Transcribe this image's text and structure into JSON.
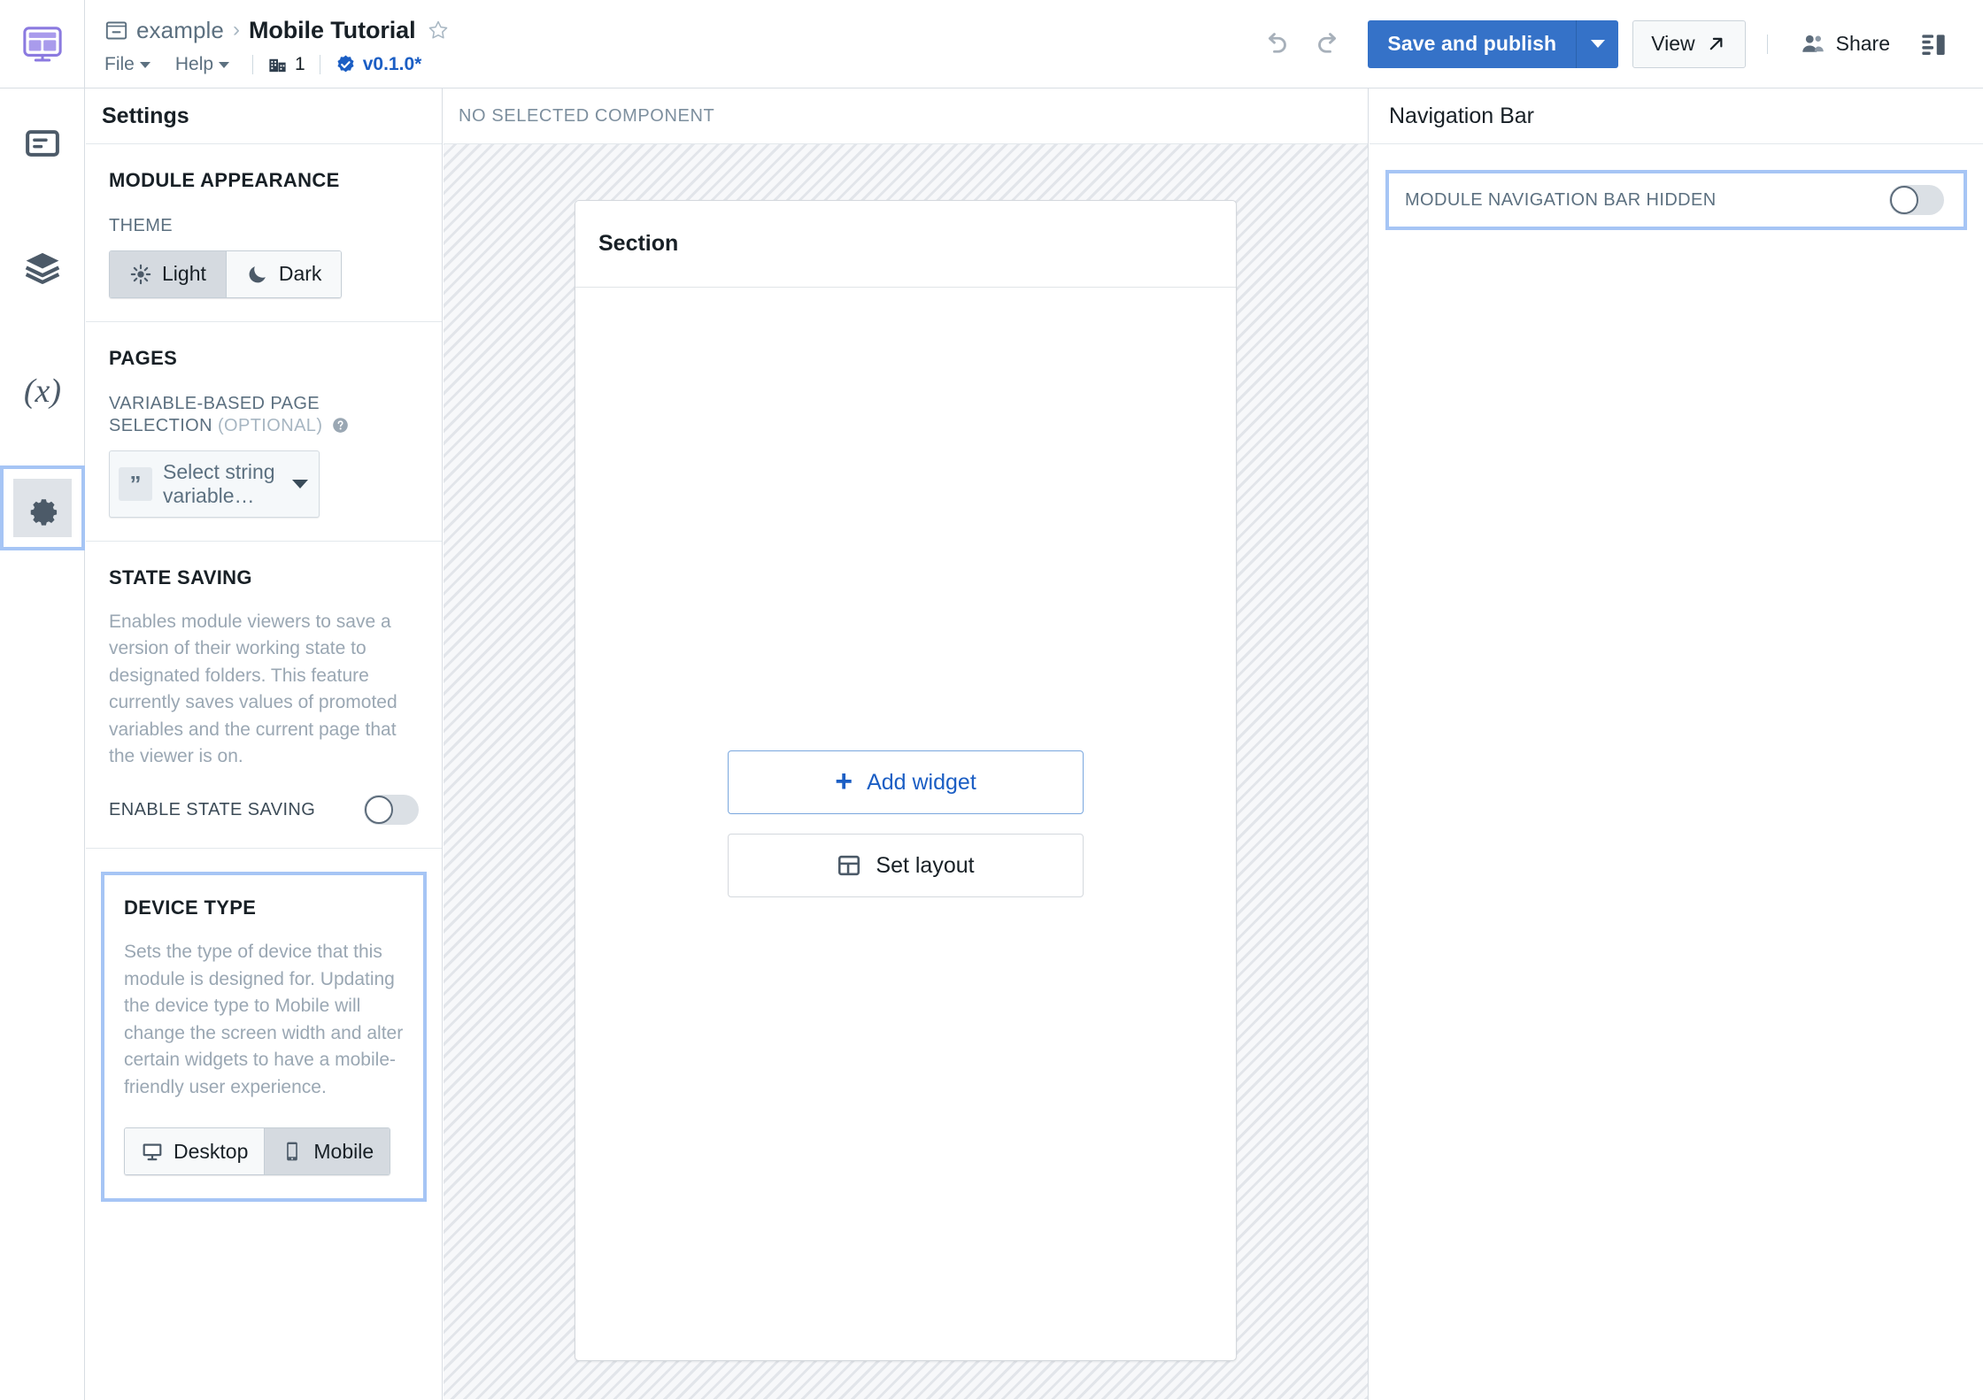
{
  "topbar": {
    "logo_icon": "workshop-logo-icon",
    "breadcrumb_parent": "example",
    "breadcrumb_separator": "›",
    "breadcrumb_current": "Mobile Tutorial",
    "star_icon": "star-outline-icon",
    "menu_file": "File",
    "menu_help": "Help",
    "org_icon": "organization-icon",
    "org_count": "1",
    "version_icon": "verified-badge-icon",
    "version_label": "v0.1.0*",
    "undo_icon": "undo-icon",
    "redo_icon": "redo-icon",
    "save_label": "Save and publish",
    "save_caret_icon": "chevron-down-icon",
    "view_label": "View",
    "view_icon": "external-link-icon",
    "share_icon": "people-icon",
    "share_label": "Share",
    "panel_toggle_icon": "panel-layout-icon"
  },
  "rail": {
    "items": [
      {
        "icon": "overview-panel-icon",
        "name": "sidebar-item-overview",
        "active": false
      },
      {
        "icon": "layers-icon",
        "name": "sidebar-item-layers",
        "active": false
      },
      {
        "icon": "variables-icon",
        "name": "sidebar-item-variables",
        "active": false
      },
      {
        "icon": "gear-icon",
        "name": "sidebar-item-settings",
        "active": true
      }
    ]
  },
  "settings": {
    "panel_title": "Settings",
    "appearance": {
      "section_title": "MODULE APPEARANCE",
      "theme_label": "THEME",
      "light_label": "Light",
      "light_icon": "sun-icon",
      "dark_label": "Dark",
      "dark_icon": "moon-icon",
      "selected": "Light"
    },
    "pages": {
      "section_title": "PAGES",
      "field_label": "VARIABLE-BASED PAGE SELECTION",
      "field_optional": "(OPTIONAL)",
      "help_icon": "help-circle-icon",
      "select_icon": "string-quote-icon",
      "select_glyph": "”",
      "select_value": "Select string variable…",
      "caret_icon": "chevron-down-icon"
    },
    "state_saving": {
      "section_title": "STATE SAVING",
      "description": "Enables module viewers to save a version of their working state to designated folders. This feature currently saves values of promoted variables and the current page that the viewer is on.",
      "toggle_label": "ENABLE STATE SAVING",
      "toggle_state": "off"
    },
    "device_type": {
      "section_title": "DEVICE TYPE",
      "description": "Sets the type of device that this module is designed for. Updating the device type to Mobile will change the screen width and alter certain widgets to have a mobile-friendly user experience.",
      "desktop_label": "Desktop",
      "desktop_icon": "desktop-monitor-icon",
      "mobile_label": "Mobile",
      "mobile_icon": "mobile-phone-icon",
      "selected": "Mobile",
      "highlighted": true
    }
  },
  "canvas": {
    "header_label": "NO SELECTED COMPONENT",
    "section_title": "Section",
    "add_widget_label": "Add widget",
    "add_widget_icon": "plus-icon",
    "set_layout_label": "Set layout",
    "set_layout_icon": "layout-grid-icon"
  },
  "right_panel": {
    "title": "Navigation Bar",
    "row_label": "MODULE NAVIGATION BAR HIDDEN",
    "toggle_state": "off",
    "highlighted": true
  },
  "colors": {
    "accent_blue": "#3572c8",
    "link_blue": "#1b5ec4",
    "highlight_border": "#a6c5f5",
    "text_dark": "#182026",
    "text_muted": "#5c7080",
    "text_light": "#9aa7b3",
    "panel_border": "#d8dde3"
  }
}
